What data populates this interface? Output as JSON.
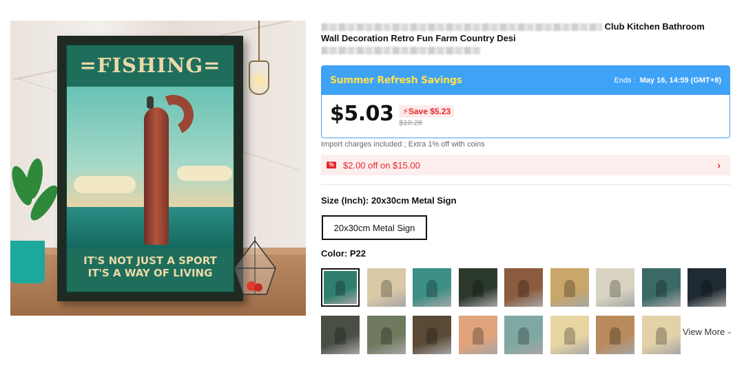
{
  "product": {
    "title_line1_visible": "Club Kitchen Bathroom",
    "title_line2": "Wall Decoration Retro Fun Farm Country Desi",
    "image": {
      "poster_title": "=FISHING=",
      "poster_slogan_line1": "IT'S NOT JUST A SPORT",
      "poster_slogan_line2": "IT'S A WAY OF LIVING"
    }
  },
  "promo": {
    "name": "Summer Refresh Savings",
    "ends_label": "Ends :",
    "ends_value": "May 16, 14:59 (GMT+8)",
    "price": "$5.03",
    "save_text": "Save $5.23",
    "original_price": "$10.26",
    "accent": "#3ea2f6",
    "sale_color": "#e8262b",
    "name_color": "#ffe14c"
  },
  "charges_note": "Import charges included ; Extra 1% off with coins",
  "coupon": {
    "icon": "coupon-ticket-icon",
    "text": "$2.00 off on $15.00",
    "arrow": "›"
  },
  "size": {
    "label": "Size (Inch): 20x30cm Metal Sign",
    "options": [
      "20x30cm Metal Sign"
    ],
    "selected": "20x30cm Metal Sign"
  },
  "color": {
    "label": "Color: P22",
    "selected_index": 0,
    "view_more": "View More",
    "swatches": [
      {
        "bg": "#2f7f6e"
      },
      {
        "bg": "#d9c9a6"
      },
      {
        "bg": "#3d8f86"
      },
      {
        "bg": "#2c3a2e"
      },
      {
        "bg": "#8a5b3d"
      },
      {
        "bg": "#c9a66a"
      },
      {
        "bg": "#d8d3c1"
      },
      {
        "bg": "#3b6a66"
      },
      {
        "bg": "#1f2b33"
      },
      {
        "bg": "#4a4f46"
      },
      {
        "bg": "#6f7a5e"
      },
      {
        "bg": "#5a4a35"
      },
      {
        "bg": "#e0a37c"
      },
      {
        "bg": "#7fa8a3"
      },
      {
        "bg": "#e8d6a2"
      },
      {
        "bg": "#b98a5c"
      },
      {
        "bg": "#e3d2a8"
      }
    ]
  }
}
